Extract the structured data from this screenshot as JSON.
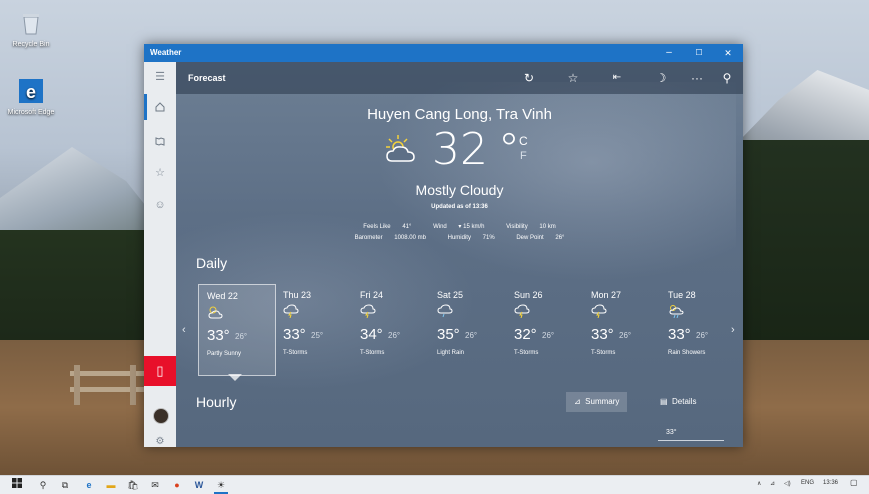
{
  "desktop": {
    "icons": [
      {
        "label": "Recycle Bin",
        "icon": "recycle-bin-icon"
      },
      {
        "label": "Microsoft Edge",
        "icon": "edge-icon"
      }
    ]
  },
  "window": {
    "title": "Weather",
    "controls": {
      "minimize": "–",
      "maximize": "☐",
      "close": "✕"
    }
  },
  "appbar": {
    "title": "Forecast",
    "actions": [
      "refresh-icon",
      "favorite-icon",
      "pin-icon",
      "dark-mode-icon",
      "more-icon",
      "search-icon"
    ]
  },
  "sidebar": {
    "items": [
      "menu-icon",
      "home-icon",
      "maps-icon",
      "favorites-icon",
      "feedback-icon"
    ],
    "active_index": 1
  },
  "current": {
    "location": "Huyen Cang Long, Tra Vinh",
    "temperature": "32",
    "degree": "°",
    "unit_c": "C",
    "unit_f": "F",
    "condition": "Mostly Cloudy",
    "updated": "Updated as of 13:36",
    "details_line1": [
      {
        "label": "Feels Like",
        "value": "41°"
      },
      {
        "label": "Wind",
        "value": "▾ 15 km/h"
      },
      {
        "label": "Visibility",
        "value": "10 km"
      }
    ],
    "details_line2": [
      {
        "label": "Barometer",
        "value": "1008.00 mb"
      },
      {
        "label": "Humidity",
        "value": "71%"
      },
      {
        "label": "Dew Point",
        "value": "26°"
      }
    ]
  },
  "daily": {
    "label": "Daily",
    "selected_index": 0,
    "days": [
      {
        "name": "Wed 22",
        "hi": "33°",
        "lo": "26°",
        "cond": "Partly Sunny",
        "icon": "partly-sunny-icon"
      },
      {
        "name": "Thu 23",
        "hi": "33°",
        "lo": "25°",
        "cond": "T-Storms",
        "icon": "thunderstorm-icon"
      },
      {
        "name": "Fri 24",
        "hi": "34°",
        "lo": "26°",
        "cond": "T-Storms",
        "icon": "thunderstorm-icon"
      },
      {
        "name": "Sat 25",
        "hi": "35°",
        "lo": "26°",
        "cond": "Light Rain",
        "icon": "light-rain-icon"
      },
      {
        "name": "Sun 26",
        "hi": "32°",
        "lo": "26°",
        "cond": "T-Storms",
        "icon": "thunderstorm-icon"
      },
      {
        "name": "Mon 27",
        "hi": "33°",
        "lo": "26°",
        "cond": "T-Storms",
        "icon": "thunderstorm-icon"
      },
      {
        "name": "Tue 28",
        "hi": "33°",
        "lo": "26°",
        "cond": "Rain Showers",
        "icon": "rain-showers-icon"
      }
    ]
  },
  "hourly": {
    "label": "Hourly",
    "summary_label": "Summary",
    "details_label": "Details",
    "first_value": "33°"
  },
  "taskbar": {
    "tray": {
      "lang": "ENG",
      "time": "13:36"
    }
  },
  "colors": {
    "accent": "#1e73c6",
    "phone": "#e8102a"
  }
}
